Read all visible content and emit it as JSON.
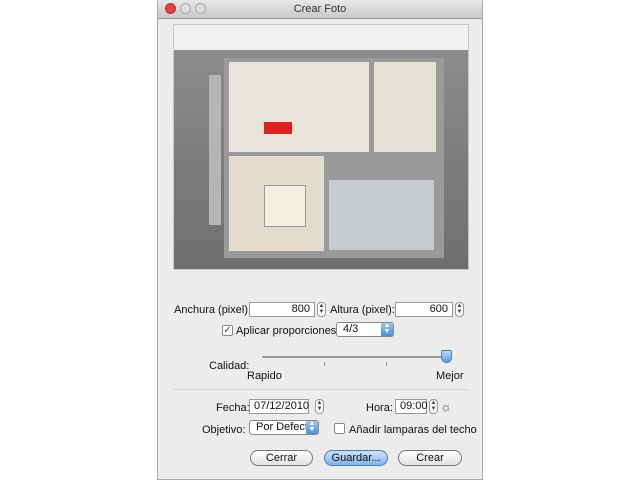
{
  "window": {
    "title": "Crear Foto"
  },
  "size": {
    "width_label": "Anchura (pixel):",
    "width_value": "800",
    "height_label": "Altura (pixel):",
    "height_value": "600"
  },
  "proportions": {
    "label": "Aplicar proporciones:",
    "checked": true,
    "value": "4/3"
  },
  "quality": {
    "label": "Calidad:",
    "min_label": "Rapido",
    "max_label": "Mejor",
    "level_percent": 100
  },
  "date": {
    "label": "Fecha:",
    "value": "07/12/2010"
  },
  "time": {
    "label": "Hora:",
    "value": "09:00",
    "icon": "sun-icon"
  },
  "lens": {
    "label": "Objetivo:",
    "value": "Por Defecto"
  },
  "ceiling_lights": {
    "label": "Añadir lamparas del techo",
    "checked": false
  },
  "buttons": {
    "close": "Cerrar",
    "save": "Guardar...",
    "create": "Crear"
  },
  "colors": {
    "accent": "#4a90d9",
    "close_light": "#e0443e"
  }
}
